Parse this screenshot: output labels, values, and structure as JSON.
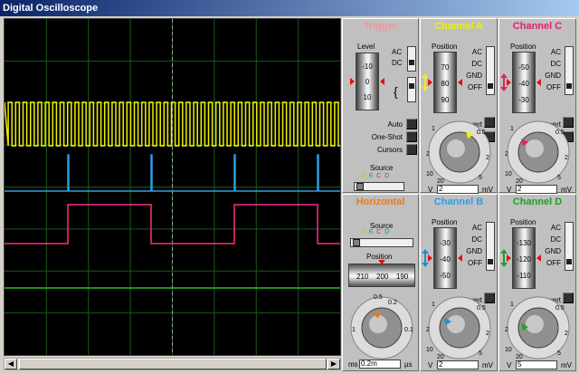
{
  "window": {
    "title": "Digital Oscilloscope"
  },
  "colors": {
    "trace_a": "#f0f000",
    "trace_b": "#2aa0e6",
    "trace_c": "#ff2a8c",
    "trace_d": "#2bc02b",
    "grid": "#1a5a1a",
    "trigger_title": "#e89b9b",
    "channel_a_title": "#f0f000",
    "channel_b_title": "#2aa0e6",
    "channel_c_title": "#e0206e",
    "channel_d_title": "#20a020",
    "horizontal_title": "#e87a1a"
  },
  "trigger": {
    "title": "Trigger",
    "level_label": "Level",
    "level_ticks": [
      "-10",
      "0",
      "10"
    ],
    "ac_label": "AC",
    "dc_label": "DC",
    "auto_label": "Auto",
    "oneshot_label": "One-Shot",
    "cursors_label": "Cursors",
    "source_label": "Source",
    "source_options": [
      "A",
      "B",
      "C",
      "D"
    ]
  },
  "horizontal": {
    "title": "Horizontal",
    "source_label": "Source",
    "source_options": [
      "A",
      "B",
      "C",
      "D"
    ],
    "position_label": "Position",
    "position_ticks": [
      "210",
      "200",
      "190"
    ],
    "knob_top": "0.5",
    "knob_top2": "0.2",
    "knob_left": "1",
    "knob_right": "0.1",
    "unit_left": "ms",
    "unit_right": "µs",
    "value": "0.2m"
  },
  "channel_a": {
    "title": "Channel A",
    "position_label": "Position",
    "ticks": [
      "70",
      "80",
      "90"
    ],
    "ac": "AC",
    "dc": "DC",
    "gnd": "GND",
    "off": "OFF",
    "invert": "Invert",
    "extra": "A+B",
    "knob_labels": [
      "1",
      "2",
      "10",
      "20",
      "5",
      "2",
      "0.5"
    ],
    "unit_left": "V",
    "unit_right": "mV",
    "value": "2"
  },
  "channel_b": {
    "title": "Channel B",
    "position_label": "Position",
    "ticks": [
      "-30",
      "-40",
      "-50"
    ],
    "ac": "AC",
    "dc": "DC",
    "gnd": "GND",
    "off": "OFF",
    "invert": "Invert",
    "knob_labels": [
      "1",
      "2",
      "10",
      "20",
      "5",
      "2",
      "0.5"
    ],
    "unit_left": "V",
    "unit_right": "mV",
    "value": "2"
  },
  "channel_c": {
    "title": "Channel C",
    "position_label": "Position",
    "ticks": [
      "-50",
      "-40",
      "-30"
    ],
    "ac": "AC",
    "dc": "DC",
    "gnd": "GND",
    "off": "OFF",
    "invert": "Invert",
    "extra": "C+D",
    "knob_labels": [
      "1",
      "2",
      "10",
      "20",
      "5",
      "2",
      "0.5"
    ],
    "unit_left": "V",
    "unit_right": "mV",
    "value": "2"
  },
  "channel_d": {
    "title": "Channel D",
    "position_label": "Position",
    "ticks": [
      "-130",
      "-120",
      "-110"
    ],
    "ac": "AC",
    "dc": "DC",
    "gnd": "GND",
    "off": "OFF",
    "invert": "Invert",
    "knob_labels": [
      "1",
      "2",
      "10",
      "20",
      "5",
      "2",
      "0.5"
    ],
    "unit_left": "V",
    "unit_right": "mV",
    "value": "5"
  }
}
